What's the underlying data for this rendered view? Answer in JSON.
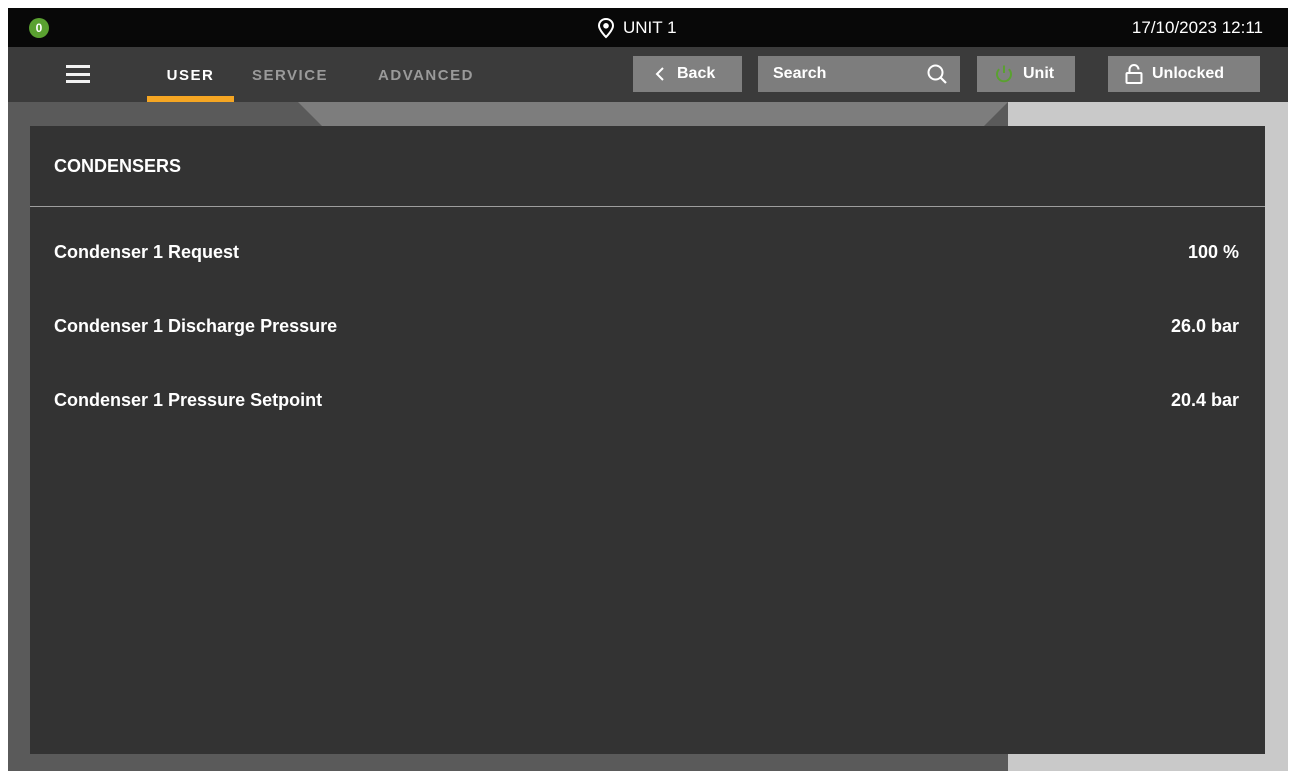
{
  "status": {
    "alarm_count": "0"
  },
  "header": {
    "unit_name": "UNIT 1",
    "datetime": "17/10/2023 12:11"
  },
  "nav": {
    "tabs": [
      {
        "label": "USER",
        "active": true
      },
      {
        "label": "SERVICE",
        "active": false
      },
      {
        "label": "ADVANCED",
        "active": false
      }
    ],
    "back_label": "Back",
    "search_label": "Search",
    "unit_label": "Unit",
    "lock_label": "Unlocked"
  },
  "panel": {
    "title": "CONDENSERS",
    "rows": [
      {
        "label": "Condenser 1 Request",
        "value": "100 %"
      },
      {
        "label": "Condenser 1 Discharge Pressure",
        "value": "26.0 bar"
      },
      {
        "label": "Condenser 1 Pressure Setpoint",
        "value": "20.4 bar"
      }
    ]
  },
  "icons": {
    "location": "location-pin-icon",
    "menu": "hamburger-menu-icon",
    "back": "chevron-left-icon",
    "search": "search-icon",
    "power": "power-icon",
    "lock": "unlocked-padlock-icon"
  },
  "colors": {
    "accent": "#f5a623",
    "status_ok": "#5aa130",
    "power": "#5aa130",
    "panel_bg": "#333333",
    "topbar_bg": "#080808"
  }
}
